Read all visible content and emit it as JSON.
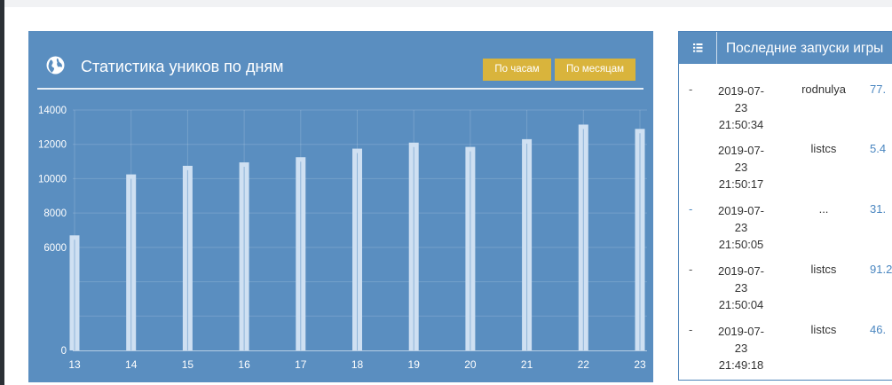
{
  "chart_panel": {
    "title": "Статистика уников по дням",
    "btn_hours": "По часам",
    "btn_months": "По месяцам"
  },
  "chart_data": {
    "type": "bar",
    "categories": [
      "13",
      "14",
      "15",
      "16",
      "17",
      "18",
      "19",
      "20",
      "21",
      "22",
      "23"
    ],
    "values": [
      6700,
      10250,
      10750,
      10950,
      11250,
      11750,
      12100,
      11850,
      12300,
      13150,
      12900
    ],
    "yticks": [
      0,
      2000,
      4000,
      6000,
      8000,
      10000,
      12000,
      14000
    ],
    "ytick_labels": [
      "0",
      "",
      "",
      "6000",
      "8000",
      "10000",
      "12000",
      "14000"
    ],
    "ylim": [
      0,
      14000
    ],
    "grid": true
  },
  "side_panel": {
    "title": "Последние запуски игры",
    "rows": [
      {
        "dash": "-",
        "date": "2019-07-",
        "day": "23",
        "time": "21:50:34",
        "name": "rodnulya",
        "score": "77."
      },
      {
        "dash": "",
        "date": "2019-07-",
        "day": "23",
        "time": "21:50:17",
        "name": "listcs",
        "score": "5.4"
      },
      {
        "dash": "-",
        "date": "2019-07-",
        "day": "23",
        "time": "21:50:05",
        "name": "...",
        "score": "31."
      },
      {
        "dash": "-",
        "date": "2019-07-",
        "day": "23",
        "time": "21:50:04",
        "name": "listcs",
        "score": "91.2"
      },
      {
        "dash": "-",
        "date": "2019-07-",
        "day": "23",
        "time": "21:49:18",
        "name": "listcs",
        "score": "46."
      }
    ]
  },
  "colors": {
    "panel_blue": "#5a8ec0",
    "button_gold": "#d9b43c",
    "link_blue": "#4a86c0"
  }
}
